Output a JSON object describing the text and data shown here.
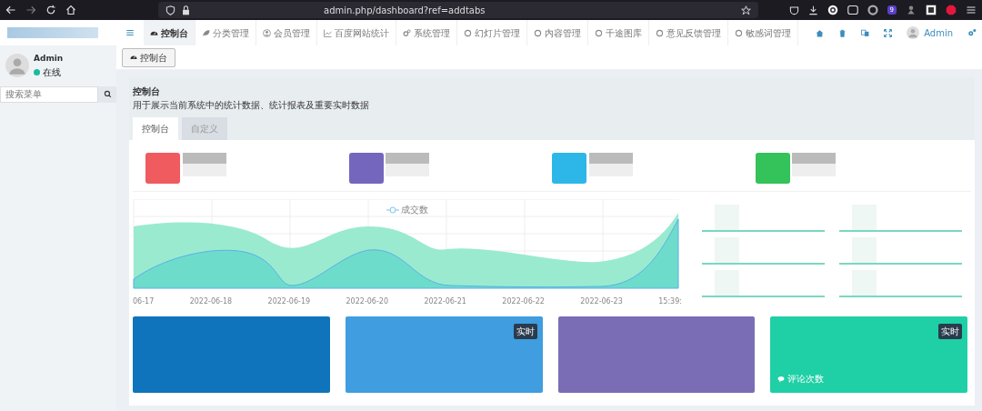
{
  "browser": {
    "url": "admin.php/dashboard?ref=addtabs",
    "extension_badge": "9"
  },
  "sidebar": {
    "user": {
      "name": "Admin",
      "status": "在线",
      "online": true
    },
    "search": {
      "placeholder": "搜索菜单"
    }
  },
  "nav_tabs": [
    {
      "label": "控制台",
      "selected": true
    },
    {
      "label": "分类管理",
      "selected": false
    },
    {
      "label": "会员管理",
      "selected": false
    },
    {
      "label": "百度网站统计",
      "selected": false
    },
    {
      "label": "系统管理",
      "selected": false
    },
    {
      "label": "幻灯片管理",
      "selected": false
    },
    {
      "label": "内容管理",
      "selected": false
    },
    {
      "label": "千途图库",
      "selected": false
    },
    {
      "label": "意见反馈管理",
      "selected": false
    },
    {
      "label": "敏感词管理",
      "selected": false
    }
  ],
  "top_right": {
    "user": "Admin"
  },
  "open_tabs": [
    {
      "label": "控制台",
      "selected": true
    }
  ],
  "panel": {
    "title": "控制台",
    "description": "用于展示当前系统中的统计数据、统计报表及重要实时数据",
    "tabs": [
      {
        "label": "控制台",
        "selected": true
      },
      {
        "label": "自定义",
        "selected": false
      }
    ]
  },
  "stat_boxes": [
    {
      "color": "#ef5b5f"
    },
    {
      "color": "#7466bd"
    },
    {
      "color": "#2db7e8"
    },
    {
      "color": "#34c25a"
    }
  ],
  "chart": {
    "legend": [
      "成交数"
    ],
    "x_labels": [
      "06-17",
      "2022-06-18",
      "2022-06-19",
      "2022-06-20",
      "2022-06-21",
      "2022-06-22",
      "2022-06-23",
      "15:39:"
    ]
  },
  "info_cards": [
    {
      "color": "#0f74bb"
    },
    {
      "color": "#3f9de0",
      "badge": "实时"
    },
    {
      "color": "#7a6db5"
    },
    {
      "color": "#1fcfa5",
      "badge": "实时",
      "caption": "评论次数"
    }
  ]
}
